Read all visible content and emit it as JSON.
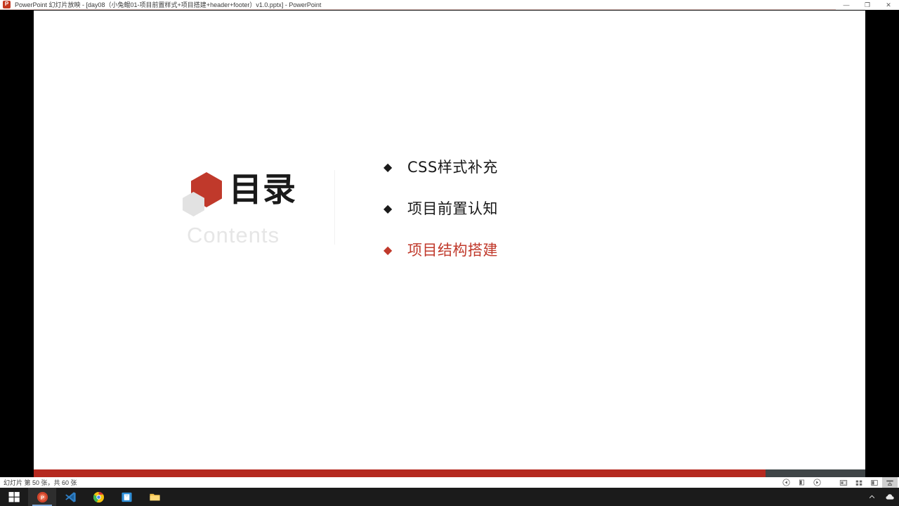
{
  "window": {
    "app_icon": "powerpoint-icon",
    "title": "PowerPoint 幻灯片放映  -  [day08（小兔鲲01-项目前置样式+项目搭建+header+footer）v1.0.pptx] - PowerPoint",
    "controls": {
      "minimize": "—",
      "maximize": "❐",
      "close": "✕"
    }
  },
  "slide": {
    "left": {
      "logo": "hexagon-logo",
      "title_cn": "目录",
      "title_en": "Contents"
    },
    "items": [
      {
        "bullet": "◆",
        "label": "CSS样式补充",
        "accent": false
      },
      {
        "bullet": "◆",
        "label": "项目前置认知",
        "accent": false
      },
      {
        "bullet": "◆",
        "label": "项目结构搭建",
        "accent": true
      }
    ]
  },
  "progress": {
    "percent": 88,
    "fill_color": "#b5291f",
    "track_color": "#3f4547"
  },
  "statusbar": {
    "text": "幻灯片 第 50 张，共 60 张",
    "current_slide": 50,
    "total_slides": 60,
    "icons": [
      "previous-slide-icon",
      "pause-slide-icon",
      "next-slide-icon",
      "normal-view-icon",
      "slide-sorter-view-icon",
      "reading-view-icon",
      "slideshow-view-icon"
    ]
  },
  "taskbar": {
    "start": "start-button-icon",
    "apps": [
      "powerpoint-taskbar-icon",
      "vscode-taskbar-icon",
      "chrome-taskbar-icon",
      "blue-app-taskbar-icon",
      "file-explorer-taskbar-icon"
    ],
    "tray": [
      "show-hidden-icons-chevron",
      "cloud-sync-icon"
    ]
  },
  "colors": {
    "accent_red": "#c0392b",
    "progress_red": "#b5291f",
    "slide_bg": "#ffffff",
    "letterbox": "#000000"
  }
}
